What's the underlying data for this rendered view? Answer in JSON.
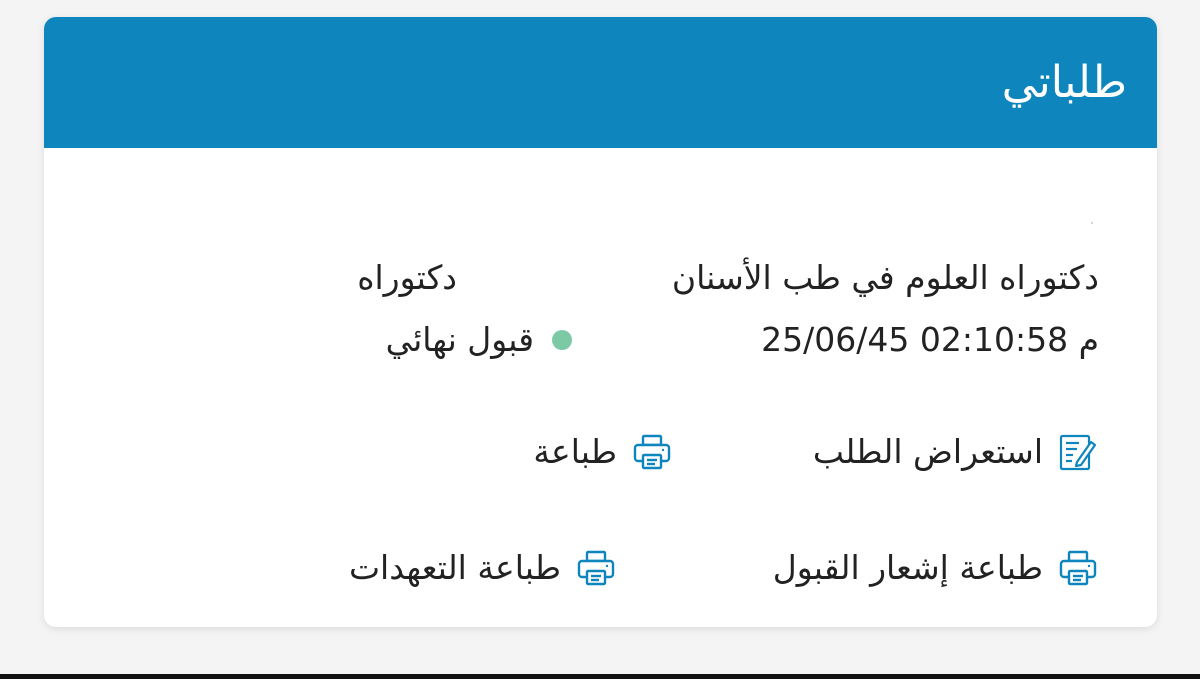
{
  "header": {
    "title": "طلباتي"
  },
  "request": {
    "program": "دكتوراه العلوم في طب الأسنان",
    "degree": "دكتوراه",
    "datetime": "25/06/45 02:10:58 م",
    "status": "قبول نهائي",
    "status_color": "#7ccaa5"
  },
  "actions": {
    "view_request": "استعراض الطلب",
    "print": "طباعة",
    "print_acceptance": "طباعة إشعار القبول",
    "print_pledges": "طباعة التعهدات"
  },
  "colors": {
    "header_bg": "#0e86bd",
    "icon": "#0e86bd"
  },
  "icons": {
    "view_request": "edit-document-icon",
    "print": "printer-icon"
  }
}
